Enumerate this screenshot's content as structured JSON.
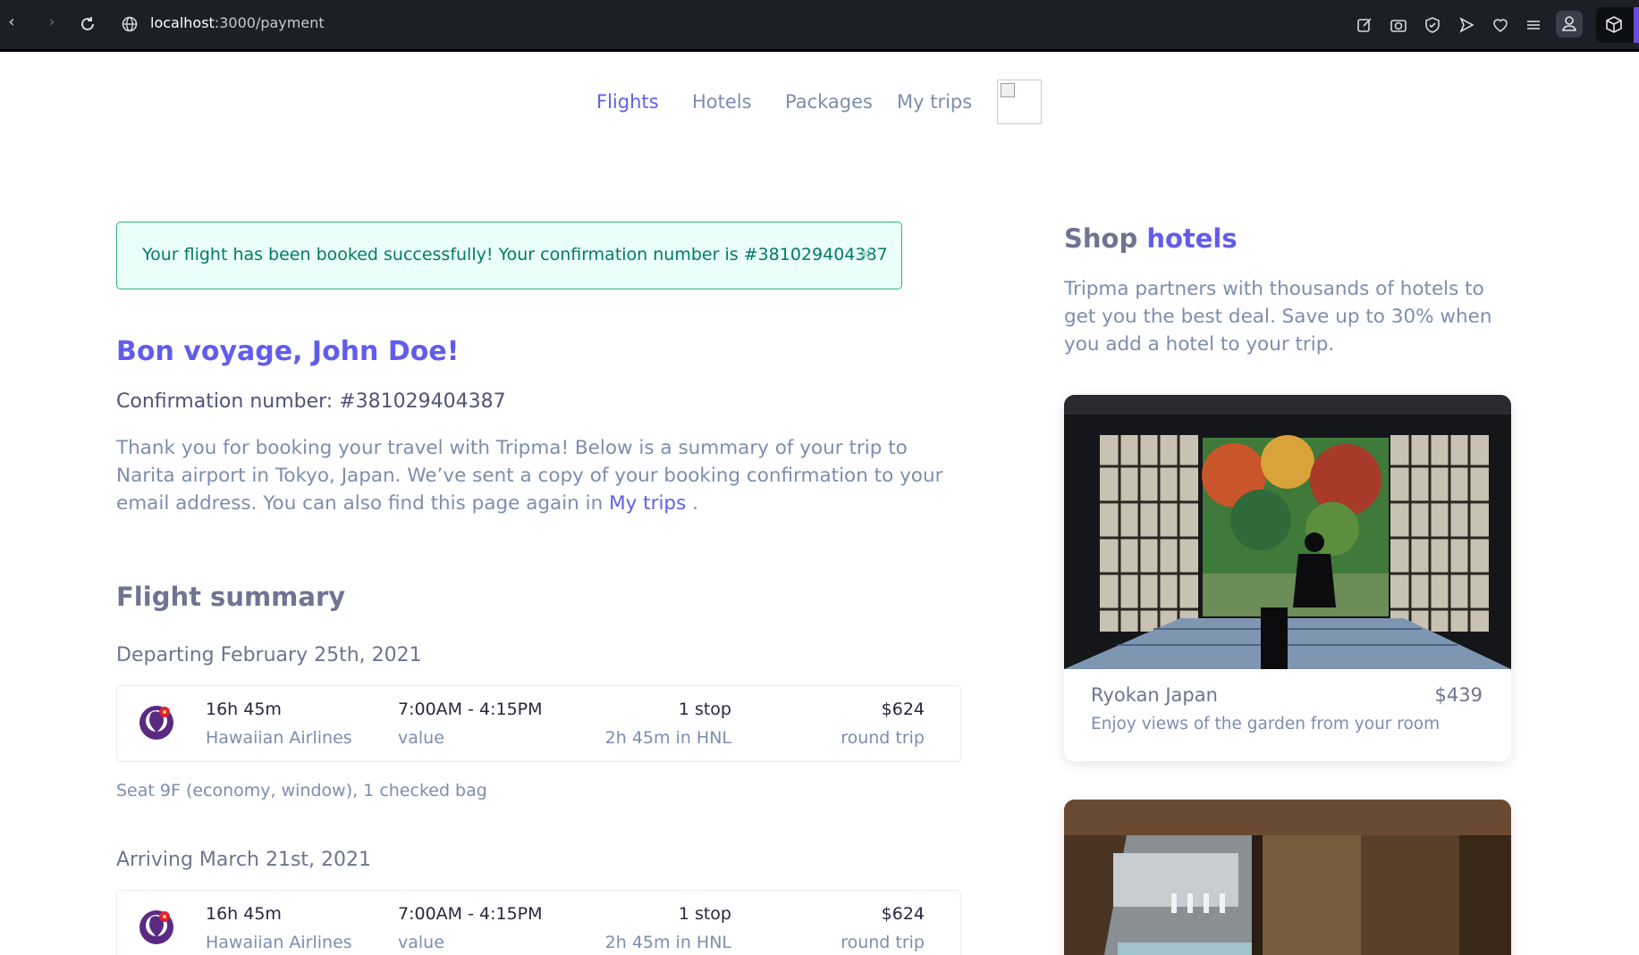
{
  "browser": {
    "url_host": "localhost",
    "url_path": ":3000/payment"
  },
  "nav": {
    "flights": "Flights",
    "hotels": "Hotels",
    "packages": "Packages",
    "my_trips": "My trips"
  },
  "alert": {
    "message": "Your flight has been booked successfully! Your confirmation number is #381029404387",
    "close": "×"
  },
  "confirmation": {
    "heading": "Bon voyage, John Doe!",
    "number_line": "Confirmation number: #381029404387",
    "thanks_text": "Thank you for booking your travel with Tripma! Below is a summary of your trip to Narita airport in Tokyo, Japan. We’ve sent a copy of your booking confirmation to your email address. You can also find this page again in ",
    "my_trips_link": "My trips",
    "thanks_end": " ."
  },
  "flight_summary": {
    "heading": "Flight summary",
    "legs": [
      {
        "title": "Departing February 25th, 2021",
        "duration": "16h 45m",
        "airline": "Hawaiian Airlines",
        "time": "7:00AM - 4:15PM",
        "fare": "value",
        "stops": "1 stop",
        "layover": "2h 45m in HNL",
        "price": "$624",
        "price_note": "round trip",
        "seat": "Seat 9F (economy, window), 1 checked bag"
      },
      {
        "title": "Arriving March 21st, 2021",
        "duration": "16h 45m",
        "airline": "Hawaiian Airlines",
        "time": "7:00AM - 4:15PM",
        "fare": "value",
        "stops": "1 stop",
        "layover": "2h 45m in HNL",
        "price": "$624",
        "price_note": "round trip"
      }
    ]
  },
  "shop_hotels": {
    "title_prefix": "Shop ",
    "title_accent": "hotels",
    "description": "Tripma partners with thousands of hotels to get you the best deal. Save up to 30% when you add a hotel to your trip.",
    "hotels": [
      {
        "name": "Ryokan Japan",
        "price": "$439",
        "description": "Enjoy views of the garden from your room"
      }
    ]
  },
  "colors": {
    "primary": "#605dec",
    "text_muted": "#7c8db0",
    "success_bg": "#eafff9",
    "success_border": "#2cb67d"
  }
}
